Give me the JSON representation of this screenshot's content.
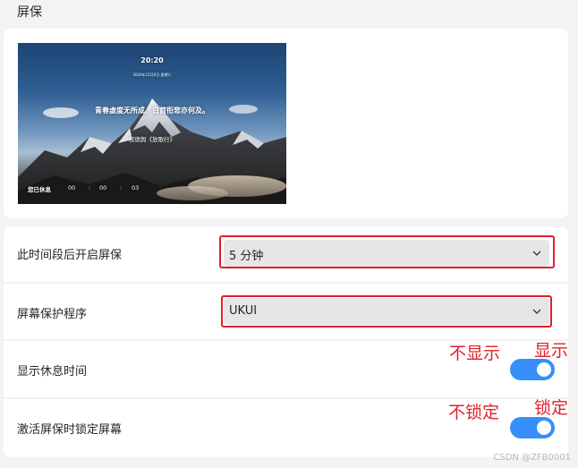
{
  "page": {
    "title": "屏保"
  },
  "preview": {
    "time": "20:20",
    "date": "2024年12月6日 星期六",
    "quote": "青春虚度无所成，白首衔悲亦何及。",
    "author": "权德舆《放歌行》",
    "rest_label": "您已休息",
    "timer": {
      "hours": "00",
      "sep1": ":",
      "minutes": "00",
      "sep2": ":",
      "seconds": "03"
    }
  },
  "settings": {
    "idle_time": {
      "label": "此时间段后开启屏保",
      "value": "5 分钟"
    },
    "program": {
      "label": "屏幕保护程序",
      "value": "UKUI"
    },
    "show_rest_time": {
      "label": "显示休息时间",
      "enabled": true
    },
    "lock_on_activate": {
      "label": "激活屏保时锁定屏幕",
      "enabled": true
    }
  },
  "annotations": {
    "hide": "不显示",
    "show": "显示",
    "no_lock": "不锁定",
    "lock": "锁定"
  },
  "watermark": "CSDN @ZFB0001",
  "colors": {
    "accent": "#3790fa",
    "highlight": "#e0202c",
    "background": "#f3f3f3",
    "card": "#ffffff",
    "combo": "#e6e6e6"
  }
}
